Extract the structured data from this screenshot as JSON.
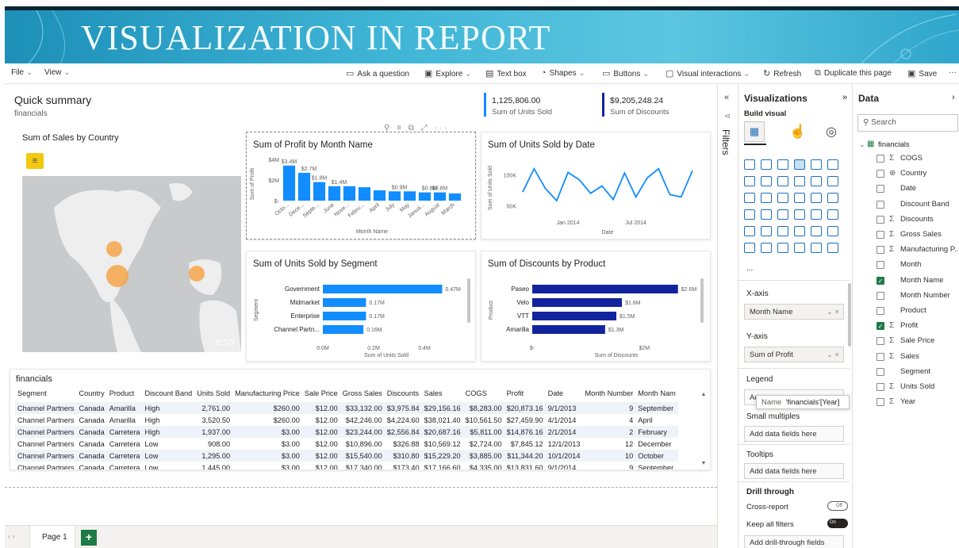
{
  "banner": {
    "title": "VISUALIZATION IN REPORT"
  },
  "toolbar": {
    "file": "File",
    "view": "View",
    "ask": "Ask a question",
    "explore": "Explore",
    "textbox": "Text box",
    "shapes": "Shapes",
    "buttons": "Buttons",
    "visual_interactions": "Visual interactions",
    "refresh": "Refresh",
    "duplicate": "Duplicate this page",
    "save": "Save"
  },
  "summary": {
    "title": "Quick summary",
    "subtitle": "financials"
  },
  "kpis": [
    {
      "value": "1,125,806.00",
      "label": "Sum of Units Sold"
    },
    {
      "value": "$9,205,248.24",
      "label": "Sum of Discounts"
    }
  ],
  "map": {
    "title": "Sum of Sales by Country",
    "watermark": "esri"
  },
  "colors": {
    "accent": "#118dff",
    "navy": "#12239e",
    "map_bubble": "#f5a54a",
    "kpi_bar": "#118dff",
    "banner": "#3fb5d6"
  },
  "chart_data": [
    {
      "type": "bar",
      "title": "Sum of Profit by Month Name",
      "xlabel": "Month Name",
      "ylabel": "Sum of Profit",
      "categories": [
        "October",
        "December",
        "September",
        "June",
        "November",
        "February",
        "April",
        "July",
        "May",
        "January",
        "August",
        "March"
      ],
      "tick_labels": [
        "Octo...",
        "Dece...",
        "Septe...",
        "June",
        "Nove...",
        "Febru...",
        "April",
        "July",
        "May",
        "Janua...",
        "August",
        "March"
      ],
      "values": [
        3.4,
        2.7,
        1.8,
        1.4,
        1.4,
        1.3,
        1.0,
        0.9,
        0.9,
        0.8,
        0.8,
        0.7
      ],
      "data_labels": [
        "$3.4M",
        "$2.7M",
        "$1.8M",
        "$1.4M",
        "",
        "",
        "",
        "$0.9M",
        "",
        "$0.8M",
        "$0.8M",
        ""
      ],
      "yticks": [
        "$4M",
        "$2M",
        "$-"
      ],
      "ylim": [
        0,
        4
      ]
    },
    {
      "type": "line",
      "title": "Sum of Units Sold by Date",
      "xlabel": "Date",
      "ylabel": "Sum of Units Sold",
      "x": [
        "2013-09",
        "2013-10",
        "2013-11",
        "2013-12",
        "2014-01",
        "2014-02",
        "2014-03",
        "2014-04",
        "2014-05",
        "2014-06",
        "2014-07",
        "2014-08",
        "2014-09",
        "2014-10",
        "2014-11",
        "2014-12"
      ],
      "values": [
        72,
        110,
        78,
        58,
        104,
        92,
        70,
        82,
        60,
        103,
        64,
        95,
        110,
        68,
        64,
        107
      ],
      "yticks": [
        "100K",
        "50K"
      ],
      "xticks": [
        "Jan 2014",
        "Jul 2014"
      ],
      "ylim": [
        40,
        120
      ]
    },
    {
      "type": "bar",
      "orientation": "horizontal",
      "title": "Sum of Units Sold by Segment",
      "xlabel": "Sum of Units Sold",
      "ylabel": "Segment",
      "categories": [
        "Government",
        "Midmarket",
        "Enterprise",
        "Channel Partn..."
      ],
      "values": [
        0.47,
        0.17,
        0.17,
        0.16
      ],
      "data_labels": [
        "0.47M",
        "0.17M",
        "0.17M",
        "0.16M"
      ],
      "xticks": [
        "0.0M",
        "0.2M",
        "0.4M"
      ],
      "xlim": [
        0,
        0.5
      ]
    },
    {
      "type": "bar",
      "orientation": "horizontal",
      "title": "Sum of Discounts by Product",
      "xlabel": "Sum of Discounts",
      "ylabel": "Product",
      "categories": [
        "Paseo",
        "Velo",
        "VTT",
        "Amarilla"
      ],
      "values": [
        2.6,
        1.6,
        1.5,
        1.3
      ],
      "data_labels": [
        "$2.6M",
        "$1.6M",
        "$1.5M",
        "$1.3M"
      ],
      "xticks": [
        "$-",
        "$2M"
      ],
      "xlim": [
        0,
        3
      ]
    }
  ],
  "table": {
    "title": "financials",
    "headers": [
      "Segment",
      "Country",
      "Product",
      "Discount Band",
      "Units Sold",
      "Manufacturing Price",
      "Sale Price",
      "Gross Sales",
      "Discounts",
      "Sales",
      "COGS",
      "Profit",
      "Date",
      "Month Number",
      "Month Nam"
    ],
    "rows": [
      [
        "Channel Partners",
        "Canada",
        "Amarilla",
        "High",
        "2,761.00",
        "$260.00",
        "$12.00",
        "$33,132.00",
        "$3,975.84",
        "$29,156.16",
        "$8,283.00",
        "$20,873.16",
        "9/1/2013",
        "9",
        "September"
      ],
      [
        "Channel Partners",
        "Canada",
        "Amarilla",
        "High",
        "3,520.50",
        "$260.00",
        "$12.00",
        "$42,246.00",
        "$4,224.60",
        "$38,021.40",
        "$10,561.50",
        "$27,459.90",
        "4/1/2014",
        "4",
        "April"
      ],
      [
        "Channel Partners",
        "Canada",
        "Carretera",
        "High",
        "1,937.00",
        "$3.00",
        "$12.00",
        "$23,244.00",
        "$2,556.84",
        "$20,687.16",
        "$5,811.00",
        "$14,876.16",
        "2/1/2014",
        "2",
        "February"
      ],
      [
        "Channel Partners",
        "Canada",
        "Carretera",
        "Low",
        "908.00",
        "$3.00",
        "$12.00",
        "$10,896.00",
        "$326.88",
        "$10,569.12",
        "$2,724.00",
        "$7,845.12",
        "12/1/2013",
        "12",
        "December"
      ],
      [
        "Channel Partners",
        "Canada",
        "Carretera",
        "Low",
        "1,295.00",
        "$3.00",
        "$12.00",
        "$15,540.00",
        "$310.80",
        "$15,229.20",
        "$3,885.00",
        "$11,344.20",
        "10/1/2014",
        "10",
        "October"
      ],
      [
        "Channel Partners",
        "Canada",
        "Carretera",
        "Low",
        "1,445.00",
        "$3.00",
        "$12.00",
        "$17,340.00",
        "$173.40",
        "$17,166.60",
        "$4,335.00",
        "$13,831.60",
        "9/1/2014",
        "9",
        "September"
      ]
    ]
  },
  "filters": {
    "label": "Filters"
  },
  "viz": {
    "title": "Visualizations",
    "build": "Build visual",
    "more": "...",
    "xaxis": "X-axis",
    "xaxis_field": "Month Name",
    "yaxis": "Y-axis",
    "yaxis_field": "Sum of Profit",
    "legend": "Legend",
    "legend_placeholder": "Ad",
    "small_multiples": "Small multiples",
    "add_fields": "Add data fields here",
    "tooltips": "Tooltips",
    "drill": "Drill through",
    "cross": "Cross-report",
    "cross_state": "Off",
    "keep": "Keep all filters",
    "keep_state": "On",
    "drill_add": "Add drill-through fields here",
    "tooltip_name": "Name",
    "tooltip_value": "'financials'[Year]"
  },
  "data": {
    "title": "Data",
    "search": "Search",
    "table": "financials",
    "fields": [
      {
        "name": "COGS",
        "sigma": true,
        "checked": false
      },
      {
        "name": "Country",
        "globe": true,
        "checked": false
      },
      {
        "name": "Date",
        "checked": false
      },
      {
        "name": "Discount Band",
        "checked": false
      },
      {
        "name": "Discounts",
        "sigma": true,
        "checked": false
      },
      {
        "name": "Gross Sales",
        "sigma": true,
        "checked": false
      },
      {
        "name": "Manufacturing P...",
        "sigma": true,
        "checked": false
      },
      {
        "name": "Month",
        "checked": false
      },
      {
        "name": "Month Name",
        "checked": true
      },
      {
        "name": "Month Number",
        "checked": false
      },
      {
        "name": "Product",
        "checked": false
      },
      {
        "name": "Profit",
        "sigma": true,
        "checked": true
      },
      {
        "name": "Sale Price",
        "sigma": true,
        "checked": false
      },
      {
        "name": "Sales",
        "sigma": true,
        "checked": false
      },
      {
        "name": "Segment",
        "checked": false
      },
      {
        "name": "Units Sold",
        "sigma": true,
        "checked": false
      },
      {
        "name": "Year",
        "sigma": true,
        "checked": false
      }
    ]
  },
  "pages": {
    "page1": "Page 1",
    "add": "+"
  }
}
